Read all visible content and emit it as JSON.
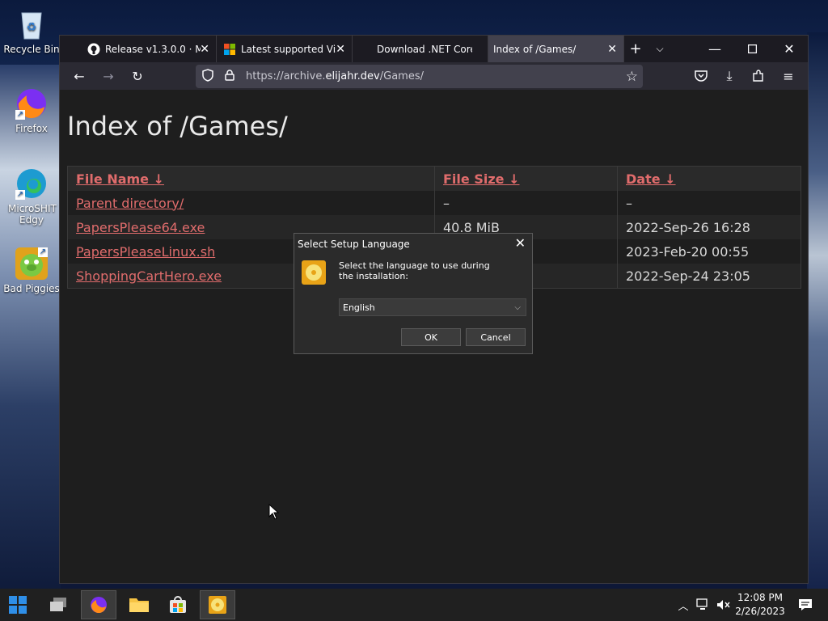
{
  "desktop": {
    "icons": [
      {
        "label": "Recycle Bin"
      },
      {
        "label": "Firefox"
      },
      {
        "label": "MicroSHIT Edgy"
      },
      {
        "label": "Bad Piggies"
      }
    ]
  },
  "browser": {
    "tabs": [
      {
        "title": "Release v1.3.0.0 · Mic",
        "icon": "github-icon"
      },
      {
        "title": "Latest supported Visu",
        "icon": "microsoft-icon"
      },
      {
        "title": "Download .NET Core",
        "icon": "dotnet-icon"
      },
      {
        "title": "Index of /Games/",
        "icon": "none",
        "active": true
      }
    ],
    "url": {
      "scheme": "https://archive.",
      "host": "elijahr.dev",
      "path": "/Games/"
    }
  },
  "page": {
    "title": "Index of /Games/",
    "columns": [
      "File Name  ↓",
      "File Size  ↓",
      "Date  ↓"
    ],
    "rows": [
      {
        "name": "Parent directory/",
        "size": "–",
        "date": "–"
      },
      {
        "name": "PapersPlease64.exe",
        "size": "40.8 MiB",
        "date": "2022-Sep-26 16:28"
      },
      {
        "name": "PapersPleaseLinux.sh",
        "size": "",
        "date": "2023-Feb-20 00:55"
      },
      {
        "name": "ShoppingCartHero.exe",
        "size": "",
        "date": "2022-Sep-24 23:05"
      }
    ]
  },
  "dialog": {
    "title": "Select Setup Language",
    "message": "Select the language to use during the installation:",
    "selected_language": "English",
    "ok_label": "OK",
    "cancel_label": "Cancel"
  },
  "taskbar": {
    "time": "12:08 PM",
    "date": "2/26/2023"
  }
}
